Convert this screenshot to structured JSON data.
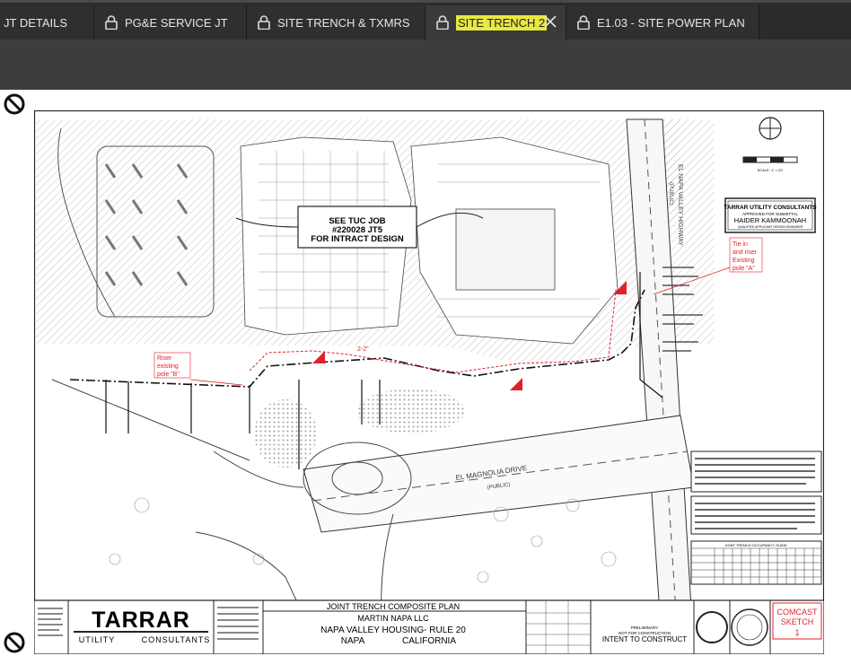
{
  "tabs": [
    {
      "label": "JT DETAILS",
      "locked": false,
      "active": false
    },
    {
      "label": "PG&E SERVICE JT",
      "locked": true,
      "active": false
    },
    {
      "label": "SITE TRENCH & TXMRS",
      "locked": true,
      "active": false
    },
    {
      "label": "SITE TRENCH 2",
      "locked": true,
      "active": true,
      "highlighted": true
    },
    {
      "label": "E1.03 - SITE POWER PLAN",
      "locked": true,
      "active": false
    }
  ],
  "drawing": {
    "callout": [
      "SEE TUC JOB",
      "#220028 JT5",
      "FOR INTRACT DESIGN"
    ],
    "street_name": "EL MAGNOLIA DRIVE",
    "street_sub": "(PUBLIC)",
    "highway": "EL NAPA VALLEY HIGHWAY",
    "highway_sub": "(PUBLIC)",
    "riser_b": [
      "Riser",
      "existing",
      "pole \"B\""
    ],
    "riser_a": [
      "Tie in",
      "and riser",
      "Existing",
      "pole \"A\""
    ],
    "dim_2_2": "2-2\"",
    "scale_label": "SCALE: 1\" = 20'",
    "stamp": {
      "company": "TARRAR UTILITY CONSULTANTS",
      "approved": "APPROVED FOR SUBMITTAL",
      "name": "HAIDER KAMMOONAH",
      "role": "QUALIFIED APPLICANT DESIGN ENGINEER"
    },
    "title_block": {
      "logo_top": "TARRAR",
      "logo_bottom_left": "UTILITY",
      "logo_bottom_right": "CONSULTANTS",
      "plan_title": "JOINT TRENCH COMPOSITE PLAN",
      "client": "MARTIN NAPA LLC",
      "project": "NAPA VALLEY HOUSING- RULE 20",
      "city": "NAPA",
      "state": "CALIFORNIA",
      "preliminary": "PRELIMINARY",
      "not_for": "NOT FOR CONSTRUCTION",
      "intent": "INTENT TO CONSTRUCT",
      "sketch_line1": "COMCAST",
      "sketch_line2": "SKETCH",
      "sketch_num": "1"
    },
    "notes_heading": "JOINT TRENCH OCCUPANCY GUIDE",
    "colors": {
      "red": "#e0202a",
      "ink": "#222222",
      "hatch": "#9a9a9a"
    }
  }
}
